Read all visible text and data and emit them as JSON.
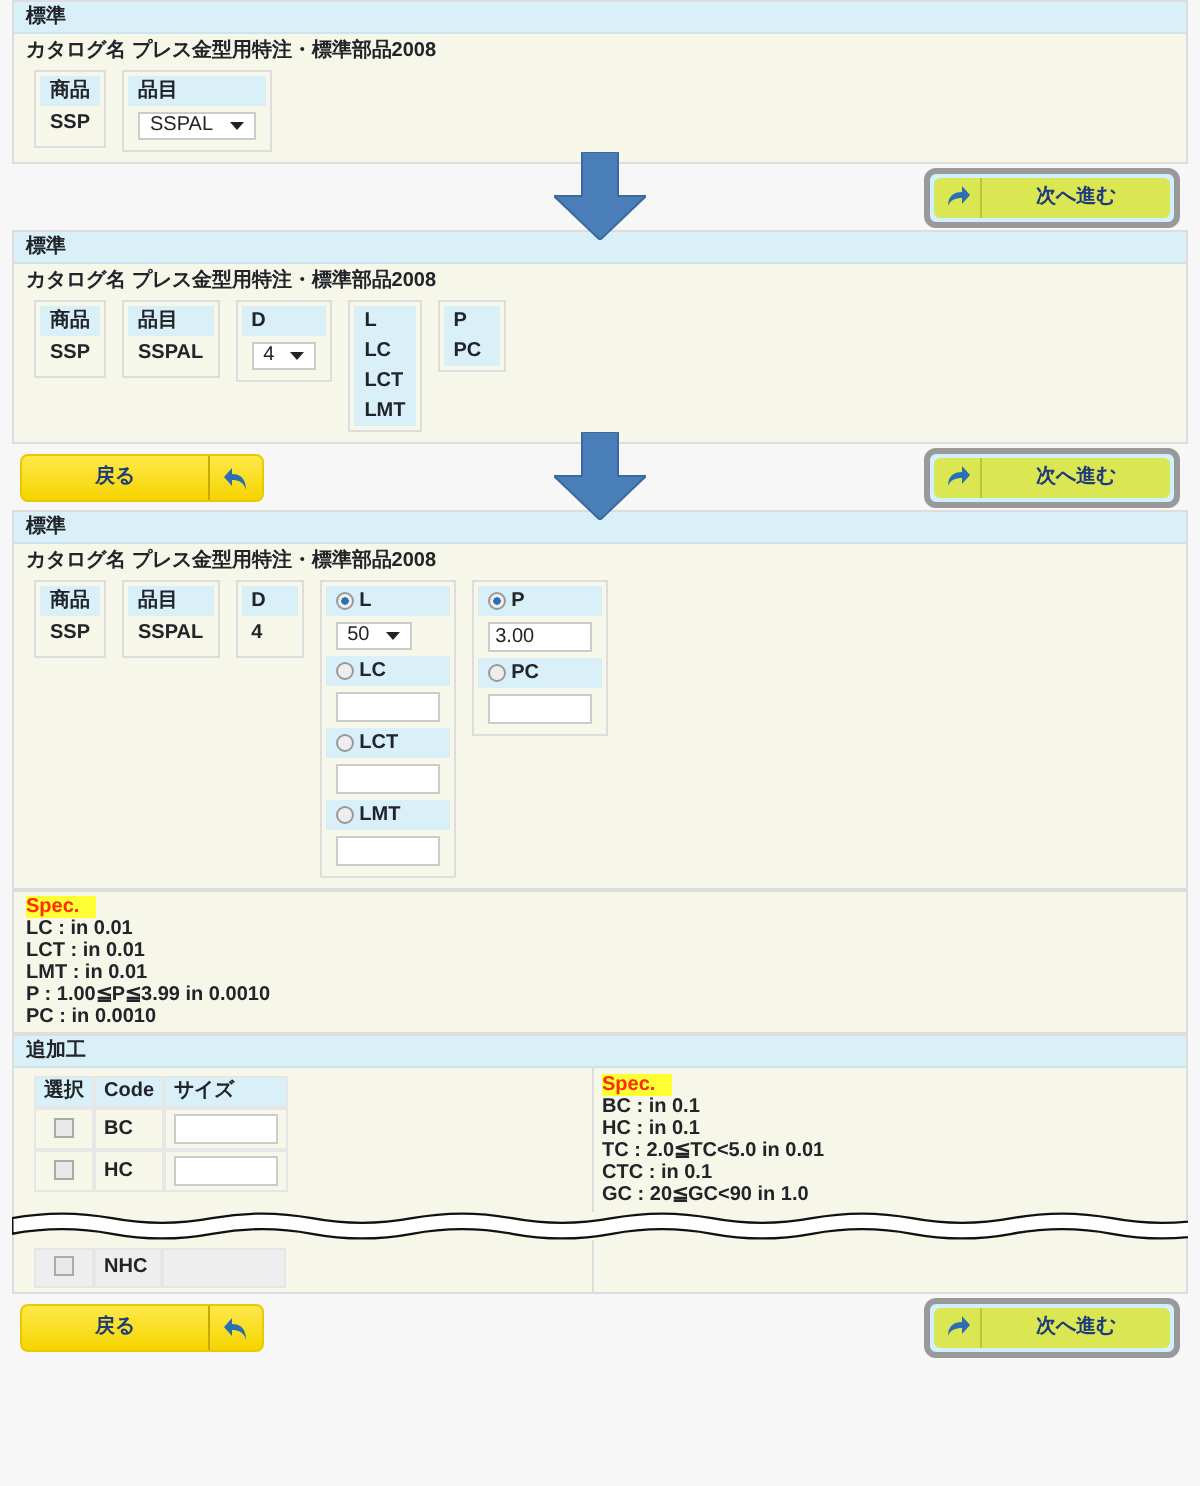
{
  "steps": [
    {
      "panel_title": "標準",
      "catalog": "カタログ名 プレス金型用特注・標準部品2008",
      "columns": [
        [
          {
            "kind": "head",
            "label": "商品"
          },
          {
            "kind": "text",
            "value": "SSP"
          }
        ],
        [
          {
            "kind": "head",
            "label": "品目"
          },
          {
            "kind": "select",
            "value": "SSPAL"
          }
        ]
      ],
      "next_button": "次へ進む"
    },
    {
      "panel_title": "標準",
      "catalog": "カタログ名 プレス金型用特注・標準部品2008",
      "columns": [
        [
          {
            "kind": "head",
            "label": "商品"
          },
          {
            "kind": "text",
            "value": "SSP"
          }
        ],
        [
          {
            "kind": "head",
            "label": "品目"
          },
          {
            "kind": "text",
            "value": "SSPAL"
          }
        ],
        [
          {
            "kind": "head",
            "label": "D"
          },
          {
            "kind": "select",
            "value": "4"
          }
        ],
        [
          {
            "kind": "head",
            "label": "L"
          },
          {
            "kind": "head",
            "label": "LC"
          },
          {
            "kind": "head",
            "label": "LCT"
          },
          {
            "kind": "head",
            "label": "LMT"
          }
        ],
        [
          {
            "kind": "head",
            "label": "P"
          },
          {
            "kind": "head",
            "label": "PC"
          }
        ]
      ],
      "back_button": "戻る",
      "next_button": "次へ進む"
    },
    {
      "panel_title": "標準",
      "catalog": "カタログ名 プレス金型用特注・標準部品2008",
      "columns": [
        [
          {
            "kind": "head",
            "label": "商品"
          },
          {
            "kind": "text",
            "value": "SSP"
          }
        ],
        [
          {
            "kind": "head",
            "label": "品目"
          },
          {
            "kind": "text",
            "value": "SSPAL"
          }
        ],
        [
          {
            "kind": "head",
            "label": "D"
          },
          {
            "kind": "text",
            "value": "4"
          }
        ],
        [
          {
            "kind": "radio",
            "label": "L",
            "selected": true
          },
          {
            "kind": "select",
            "value": "50"
          },
          {
            "kind": "radio",
            "label": "LC",
            "selected": false
          },
          {
            "kind": "input"
          },
          {
            "kind": "radio",
            "label": "LCT",
            "selected": false
          },
          {
            "kind": "input"
          },
          {
            "kind": "radio",
            "label": "LMT",
            "selected": false
          },
          {
            "kind": "input"
          }
        ],
        [
          {
            "kind": "radio",
            "label": "P",
            "selected": true
          },
          {
            "kind": "input",
            "value": "3.00"
          },
          {
            "kind": "radio",
            "label": "PC",
            "selected": false
          },
          {
            "kind": "input"
          }
        ]
      ],
      "spec": {
        "label": "Spec.",
        "lines": [
          "LC : in 0.01",
          "LCT : in 0.01",
          "LMT : in 0.01",
          "P : 1.00≦P≦3.99 in 0.0010",
          "PC : in 0.0010"
        ]
      },
      "extra": {
        "title": "追加工",
        "headers": [
          "選択",
          "Code",
          "サイズ"
        ],
        "rows_top": [
          {
            "code": "BC",
            "checked": false,
            "has_input": true
          },
          {
            "code": "HC",
            "checked": false,
            "has_input": true
          }
        ],
        "rows_bottom": [
          {
            "code": "NHC",
            "checked": false,
            "has_input": false
          }
        ],
        "spec": {
          "label": "Spec.",
          "lines": [
            "BC : in 0.1",
            "HC : in 0.1",
            "TC : 2.0≦TC<5.0 in 0.01",
            "CTC : in 0.1",
            "GC : 20≦GC<90 in 1.0"
          ]
        }
      },
      "back_button": "戻る",
      "next_button": "次へ進む"
    }
  ]
}
